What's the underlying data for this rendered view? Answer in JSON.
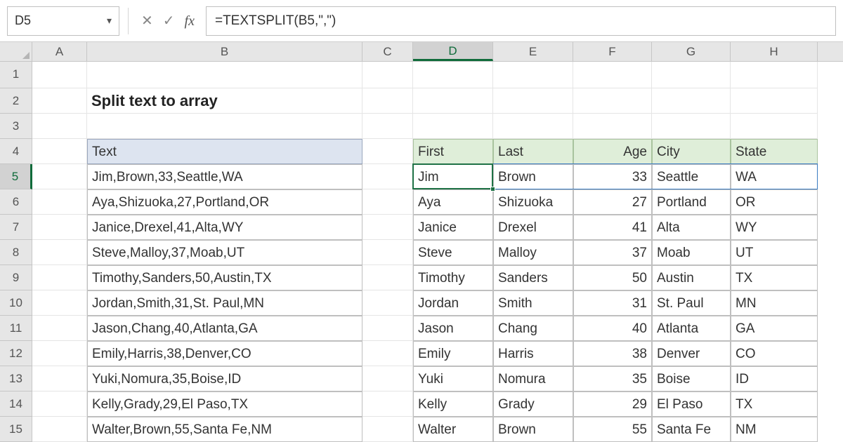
{
  "name_box": "D5",
  "formula": "=TEXTSPLIT(B5,\",\")",
  "title": "Split text to array",
  "columns": [
    "A",
    "B",
    "C",
    "D",
    "E",
    "F",
    "G",
    "H"
  ],
  "rows": [
    "1",
    "2",
    "3",
    "4",
    "5",
    "6",
    "7",
    "8",
    "9",
    "10",
    "11",
    "12",
    "13",
    "14",
    "15"
  ],
  "table1_header": "Text",
  "table1_rows": [
    "Jim,Brown,33,Seattle,WA",
    "Aya,Shizuoka,27,Portland,OR",
    "Janice,Drexel,41,Alta,WY",
    "Steve,Malloy,37,Moab,UT",
    "Timothy,Sanders,50,Austin,TX",
    "Jordan,Smith,31,St. Paul,MN",
    "Jason,Chang,40,Atlanta,GA",
    "Emily,Harris,38,Denver,CO",
    "Yuki,Nomura,35,Boise,ID",
    "Kelly,Grady,29,El Paso,TX",
    "Walter,Brown,55,Santa Fe,NM"
  ],
  "table2_headers": [
    "First",
    "Last",
    "Age",
    "City",
    "State"
  ],
  "table2_rows": [
    [
      "Jim",
      "Brown",
      "33",
      "Seattle",
      "WA"
    ],
    [
      "Aya",
      "Shizuoka",
      "27",
      "Portland",
      "OR"
    ],
    [
      "Janice",
      "Drexel",
      "41",
      "Alta",
      "WY"
    ],
    [
      "Steve",
      "Malloy",
      "37",
      "Moab",
      "UT"
    ],
    [
      "Timothy",
      "Sanders",
      "50",
      "Austin",
      "TX"
    ],
    [
      "Jordan",
      "Smith",
      "31",
      "St. Paul",
      "MN"
    ],
    [
      "Jason",
      "Chang",
      "40",
      "Atlanta",
      "GA"
    ],
    [
      "Emily",
      "Harris",
      "38",
      "Denver",
      "CO"
    ],
    [
      "Yuki",
      "Nomura",
      "35",
      "Boise",
      "ID"
    ],
    [
      "Kelly",
      "Grady",
      "29",
      "El Paso",
      "TX"
    ],
    [
      "Walter",
      "Brown",
      "55",
      "Santa Fe",
      "NM"
    ]
  ],
  "col_widths": {
    "A": 78,
    "B": 392,
    "C": 72,
    "D": 114,
    "E": 114,
    "F": 112,
    "G": 112,
    "H": 124
  }
}
